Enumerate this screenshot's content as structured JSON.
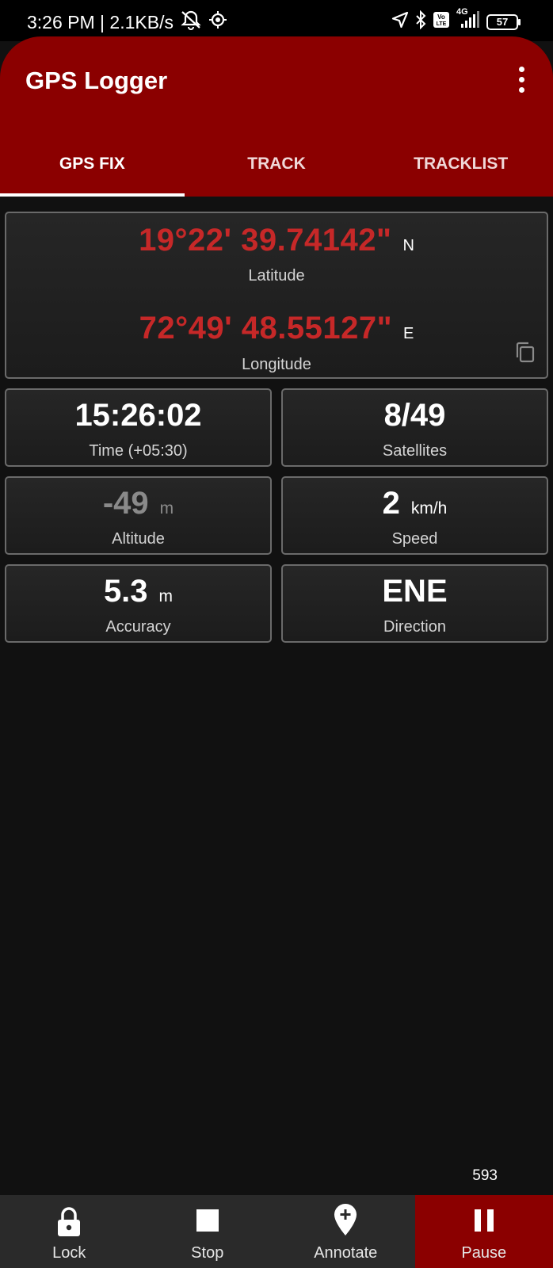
{
  "status_bar": {
    "time_speed": "3:26 PM | 2.1KB/s",
    "network": "4G",
    "volte": "Vo LTE",
    "battery": "57",
    "icons": [
      "alarm-off-icon",
      "location-target-icon",
      "location-arrow-icon",
      "bluetooth-icon",
      "volte-icon",
      "signal-icon",
      "battery-icon"
    ]
  },
  "app": {
    "title": "GPS Logger",
    "menu_icon": "more-vert-icon"
  },
  "tabs": [
    {
      "label": "GPS FIX",
      "active": true
    },
    {
      "label": "TRACK",
      "active": false
    },
    {
      "label": "TRACKLIST",
      "active": false
    }
  ],
  "coords": {
    "latitude": {
      "value": "19°22' 39.74142\"",
      "dir": "N",
      "label": "Latitude"
    },
    "longitude": {
      "value": "72°49' 48.55127\"",
      "dir": "E",
      "label": "Longitude"
    },
    "copy_icon": "copy-icon"
  },
  "stats": {
    "time": {
      "value": "15:26:02",
      "label": "Time (+05:30)"
    },
    "satellites": {
      "value": "8/49",
      "label": "Satellites"
    },
    "altitude": {
      "value": "-49",
      "unit": "m",
      "label": "Altitude"
    },
    "speed": {
      "value": "2",
      "unit": "km/h",
      "label": "Speed"
    },
    "accuracy": {
      "value": "5.3",
      "unit": "m",
      "label": "Accuracy"
    },
    "direction": {
      "value": "ENE",
      "label": "Direction"
    }
  },
  "counter": "593",
  "bottom_nav": [
    {
      "label": "Lock",
      "icon": "lock-icon",
      "active": false
    },
    {
      "label": "Stop",
      "icon": "stop-icon",
      "active": false
    },
    {
      "label": "Annotate",
      "icon": "add-location-icon",
      "active": false
    },
    {
      "label": "Pause",
      "icon": "pause-icon",
      "active": true
    }
  ],
  "colors": {
    "accent": "#8b0000",
    "coordinate_red": "#c62828",
    "background": "#111111"
  }
}
